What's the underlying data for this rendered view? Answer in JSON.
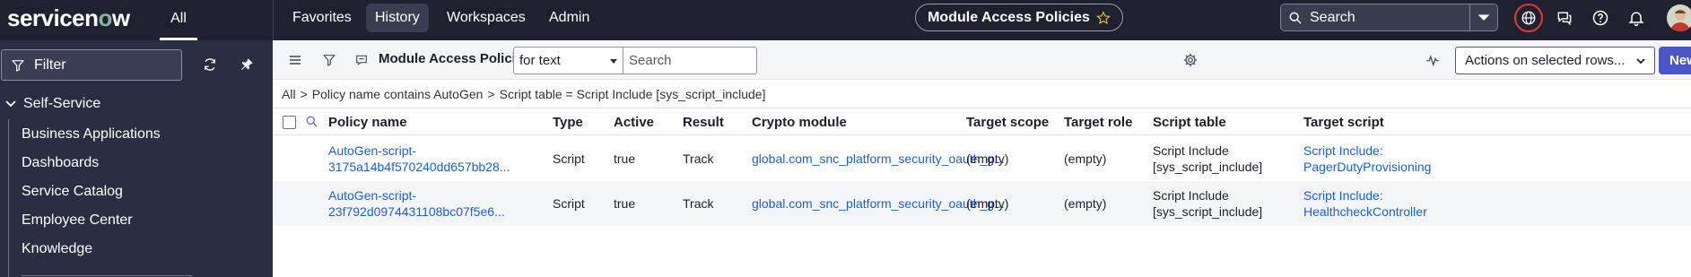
{
  "topnav": {
    "logo_pre": "servicen",
    "logo_o": "o",
    "logo_post": "w",
    "all_label": "All",
    "links": [
      "Favorites",
      "History",
      "Workspaces",
      "Admin"
    ],
    "active_link": "History",
    "page_title": "Module Access Policies",
    "search_label": "Search",
    "icons": [
      "globe-icon",
      "chat-icon",
      "help-icon",
      "bell-icon",
      "user-avatar"
    ],
    "colors": {
      "bar": "#1f2130",
      "accent_ring": "#e53935"
    }
  },
  "sidebar": {
    "filter_label": "Filter",
    "section": "Self-Service",
    "items": [
      "Business Applications",
      "Dashboards",
      "Service Catalog",
      "Employee Center",
      "Knowledge"
    ]
  },
  "toolbar": {
    "list_title": "Module Access Policies",
    "search_field": "for text",
    "search_placeholder": "Search",
    "actions_label": "Actions on selected rows...",
    "new_label": "New"
  },
  "breadcrumb": [
    "All",
    "Policy name contains AutoGen",
    "Script table = Script Include [sys_script_include]"
  ],
  "table": {
    "columns": [
      "Policy name",
      "Type",
      "Active",
      "Result",
      "Crypto module",
      "Target scope",
      "Target role",
      "Script table",
      "Target script"
    ],
    "rows": [
      {
        "policy_line1": "AutoGen-script-",
        "policy_line2": "3175a14b4f570240dd657bb28...",
        "type": "Script",
        "active": "true",
        "result": "Track",
        "crypto": "global.com_snc_platform_security_oauth_g...",
        "scope": "(empty)",
        "role": "(empty)",
        "table_line1": "Script Include",
        "table_line2": "[sys_script_include]",
        "target_line1": "Script Include:",
        "target_line2": "PagerDutyProvisioning"
      },
      {
        "policy_line1": "AutoGen-script-",
        "policy_line2": "23f792d0974431108bc07f5e6...",
        "type": "Script",
        "active": "true",
        "result": "Track",
        "crypto": "global.com_snc_platform_security_oauth_g...",
        "scope": "(empty)",
        "role": "(empty)",
        "table_line1": "Script Include",
        "table_line2": "[sys_script_include]",
        "target_line1": "Script Include:",
        "target_line2": "HealthcheckController"
      }
    ]
  }
}
